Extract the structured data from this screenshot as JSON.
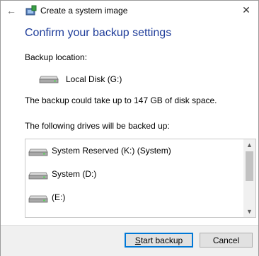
{
  "window": {
    "title": "Create a system image",
    "close_symbol": "✕",
    "back_symbol": "←"
  },
  "heading": "Confirm your backup settings",
  "backup_location": {
    "label": "Backup location:",
    "drive": "Local Disk (G:)",
    "icon": "hard-disk-icon"
  },
  "space_note": "The backup could take up to 147 GB of disk space.",
  "drives_label": "The following drives will be backed up:",
  "drives": [
    {
      "label": "System Reserved (K:) (System)",
      "icon": "hard-disk-icon"
    },
    {
      "label": "System (D:)",
      "icon": "hard-disk-icon"
    },
    {
      "label": "(E:)",
      "icon": "hard-disk-icon"
    }
  ],
  "buttons": {
    "start_mnemonic": "S",
    "start_rest": "tart backup",
    "cancel": "Cancel"
  },
  "colors": {
    "heading": "#1f3d9a",
    "primary_border": "#0078d7",
    "footer_bg": "#f0f0f0"
  }
}
